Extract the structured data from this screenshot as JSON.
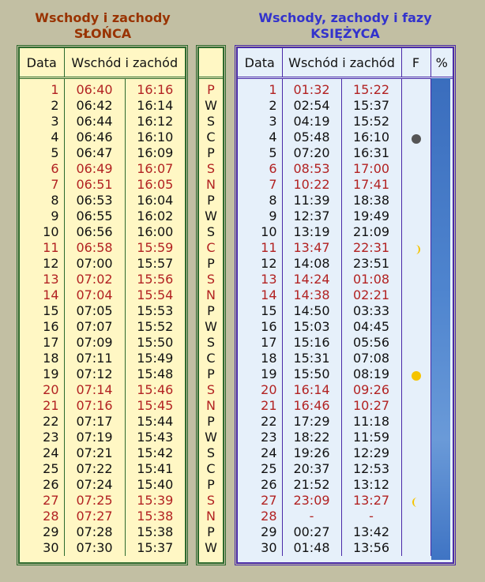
{
  "sun": {
    "title_line1": "Wschody i zachody",
    "title_line2": "SŁOŃCA",
    "col_date": "Data",
    "col_times": "Wschód i zachód"
  },
  "moon": {
    "title_line1": "Wschody, zachody i fazy",
    "title_line2": "KSIĘŻYCA",
    "col_date": "Data",
    "col_times": "Wschód i zachód",
    "col_phase": "F",
    "col_percent": "%"
  },
  "colors": {
    "weekend": "#b22222",
    "sun_border": "#2d6a2d",
    "moon_border": "#4a2aa8"
  },
  "days": [
    {
      "d": "1",
      "sr": "06:40",
      "ss": "16:16",
      "wd": "P",
      "mr": "01:32",
      "ms": "15:22",
      "red": true
    },
    {
      "d": "2",
      "sr": "06:42",
      "ss": "16:14",
      "wd": "W",
      "mr": "02:54",
      "ms": "15:37",
      "red": false
    },
    {
      "d": "3",
      "sr": "06:44",
      "ss": "16:12",
      "wd": "S",
      "mr": "04:19",
      "ms": "15:52",
      "red": false
    },
    {
      "d": "4",
      "sr": "06:46",
      "ss": "16:10",
      "wd": "C",
      "mr": "05:48",
      "ms": "16:10",
      "red": false,
      "phase": "new-moon-icon"
    },
    {
      "d": "5",
      "sr": "06:47",
      "ss": "16:09",
      "wd": "P",
      "mr": "07:20",
      "ms": "16:31",
      "red": false
    },
    {
      "d": "6",
      "sr": "06:49",
      "ss": "16:07",
      "wd": "S",
      "mr": "08:53",
      "ms": "17:00",
      "red": true
    },
    {
      "d": "7",
      "sr": "06:51",
      "ss": "16:05",
      "wd": "N",
      "mr": "10:22",
      "ms": "17:41",
      "red": true
    },
    {
      "d": "8",
      "sr": "06:53",
      "ss": "16:04",
      "wd": "P",
      "mr": "11:39",
      "ms": "18:38",
      "red": false
    },
    {
      "d": "9",
      "sr": "06:55",
      "ss": "16:02",
      "wd": "W",
      "mr": "12:37",
      "ms": "19:49",
      "red": false
    },
    {
      "d": "10",
      "sr": "06:56",
      "ss": "16:00",
      "wd": "S",
      "mr": "13:19",
      "ms": "21:09",
      "red": false
    },
    {
      "d": "11",
      "sr": "06:58",
      "ss": "15:59",
      "wd": "C",
      "mr": "13:47",
      "ms": "22:31",
      "red": true,
      "phase": "first-quarter-icon"
    },
    {
      "d": "12",
      "sr": "07:00",
      "ss": "15:57",
      "wd": "P",
      "mr": "14:08",
      "ms": "23:51",
      "red": false
    },
    {
      "d": "13",
      "sr": "07:02",
      "ss": "15:56",
      "wd": "S",
      "mr": "14:24",
      "ms": "01:08",
      "red": true
    },
    {
      "d": "14",
      "sr": "07:04",
      "ss": "15:54",
      "wd": "N",
      "mr": "14:38",
      "ms": "02:21",
      "red": true
    },
    {
      "d": "15",
      "sr": "07:05",
      "ss": "15:53",
      "wd": "P",
      "mr": "14:50",
      "ms": "03:33",
      "red": false
    },
    {
      "d": "16",
      "sr": "07:07",
      "ss": "15:52",
      "wd": "W",
      "mr": "15:03",
      "ms": "04:45",
      "red": false
    },
    {
      "d": "17",
      "sr": "07:09",
      "ss": "15:50",
      "wd": "S",
      "mr": "15:16",
      "ms": "05:56",
      "red": false
    },
    {
      "d": "18",
      "sr": "07:11",
      "ss": "15:49",
      "wd": "C",
      "mr": "15:31",
      "ms": "07:08",
      "red": false
    },
    {
      "d": "19",
      "sr": "07:12",
      "ss": "15:48",
      "wd": "P",
      "mr": "15:50",
      "ms": "08:19",
      "red": false,
      "phase": "full-moon-icon"
    },
    {
      "d": "20",
      "sr": "07:14",
      "ss": "15:46",
      "wd": "S",
      "mr": "16:14",
      "ms": "09:26",
      "red": true
    },
    {
      "d": "21",
      "sr": "07:16",
      "ss": "15:45",
      "wd": "N",
      "mr": "16:46",
      "ms": "10:27",
      "red": true
    },
    {
      "d": "22",
      "sr": "07:17",
      "ss": "15:44",
      "wd": "P",
      "mr": "17:29",
      "ms": "11:18",
      "red": false
    },
    {
      "d": "23",
      "sr": "07:19",
      "ss": "15:43",
      "wd": "W",
      "mr": "18:22",
      "ms": "11:59",
      "red": false
    },
    {
      "d": "24",
      "sr": "07:21",
      "ss": "15:42",
      "wd": "S",
      "mr": "19:26",
      "ms": "12:29",
      "red": false
    },
    {
      "d": "25",
      "sr": "07:22",
      "ss": "15:41",
      "wd": "C",
      "mr": "20:37",
      "ms": "12:53",
      "red": false
    },
    {
      "d": "26",
      "sr": "07:24",
      "ss": "15:40",
      "wd": "P",
      "mr": "21:52",
      "ms": "13:12",
      "red": false
    },
    {
      "d": "27",
      "sr": "07:25",
      "ss": "15:39",
      "wd": "S",
      "mr": "23:09",
      "ms": "13:27",
      "red": true,
      "phase": "last-quarter-icon"
    },
    {
      "d": "28",
      "sr": "07:27",
      "ss": "15:38",
      "wd": "N",
      "mr": "-",
      "ms": "-",
      "red": true
    },
    {
      "d": "29",
      "sr": "07:28",
      "ss": "15:38",
      "wd": "P",
      "mr": "00:27",
      "ms": "13:42",
      "red": false
    },
    {
      "d": "30",
      "sr": "07:30",
      "ss": "15:37",
      "wd": "W",
      "mr": "01:48",
      "ms": "13:56",
      "red": false
    }
  ]
}
